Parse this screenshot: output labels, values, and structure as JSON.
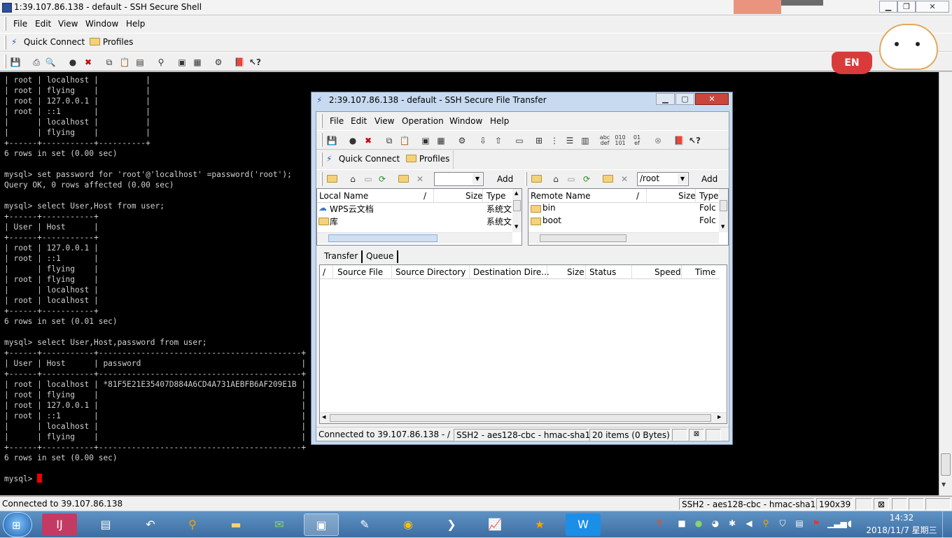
{
  "main_window": {
    "title": "1:39.107.86.138 - default - SSH Secure Shell",
    "menu": [
      "File",
      "Edit",
      "View",
      "Window",
      "Help"
    ],
    "quick_connect_label": "Quick Connect",
    "profiles_label": "Profiles",
    "terminal_lines": [
      "| root | localhost |          |",
      "| root | flying    |          |",
      "| root | 127.0.0.1 |          |",
      "| root | ::1       |          |",
      "|      | localhost |          |",
      "|      | flying    |          |",
      "+------+-----------+----------+",
      "6 rows in set (0.00 sec)",
      "",
      "mysql> set password for 'root'@'localhost' =password('root');",
      "Query OK, 0 rows affected (0.00 sec)",
      "",
      "mysql> select User,Host from user;",
      "+------+-----------+",
      "| User | Host      |",
      "+------+-----------+",
      "| root | 127.0.0.1 |",
      "| root | ::1       |",
      "|      | flying    |",
      "| root | flying    |",
      "|      | localhost |",
      "| root | localhost |",
      "+------+-----------+",
      "6 rows in set (0.01 sec)",
      "",
      "mysql> select User,Host,password from user;",
      "+------+-----------+-------------------------------------------+",
      "| User | Host      | password                                  |",
      "+------+-----------+-------------------------------------------+",
      "| root | localhost | *81F5E21E35407D884A6CD4A731AEBFB6AF209E1B |",
      "| root | flying    |                                           |",
      "| root | 127.0.0.1 |                                           |",
      "| root | ::1       |                                           |",
      "|      | localhost |                                           |",
      "|      | flying    |                                           |",
      "+------+-----------+-------------------------------------------+",
      "6 rows in set (0.00 sec)",
      ""
    ],
    "prompt": "mysql> ",
    "status": {
      "connected": "Connected to 39.107.86.138",
      "cipher": "SSH2 - aes128-cbc - hmac-sha1",
      "size": "190x39"
    }
  },
  "sftp_window": {
    "title": "2:39.107.86.138 - default - SSH Secure File Transfer",
    "menu": [
      "File",
      "Edit",
      "View",
      "Operation",
      "Window",
      "Help"
    ],
    "quick_connect_label": "Quick Connect",
    "profiles_label": "Profiles",
    "add_label": "Add",
    "remote_path": "/root",
    "local_columns": [
      "Local Name",
      "/",
      "Size",
      "Type"
    ],
    "local_rows": [
      {
        "name": "WPS云文档",
        "type": "系统文"
      },
      {
        "name": "库",
        "type": "系统文"
      }
    ],
    "remote_columns": [
      "Remote Name",
      "/",
      "Size",
      "Type"
    ],
    "remote_rows": [
      {
        "name": "bin",
        "type": "Folc"
      },
      {
        "name": "boot",
        "type": "Folc"
      }
    ],
    "tabs": [
      "Transfer",
      "Queue"
    ],
    "transfer_columns": [
      "/",
      "Source File",
      "Source Directory",
      "Destination Dire...",
      "Size",
      "Status",
      "Speed",
      "Time"
    ],
    "status": {
      "connected": "Connected to 39.107.86.138 - /",
      "cipher": "SSH2 - aes128-cbc - hmac-sha1",
      "items": "20 items (0 Bytes)"
    }
  },
  "ime_badge": "EN",
  "clock": {
    "time": "14:32",
    "date": "2018/11/7 星期三"
  }
}
